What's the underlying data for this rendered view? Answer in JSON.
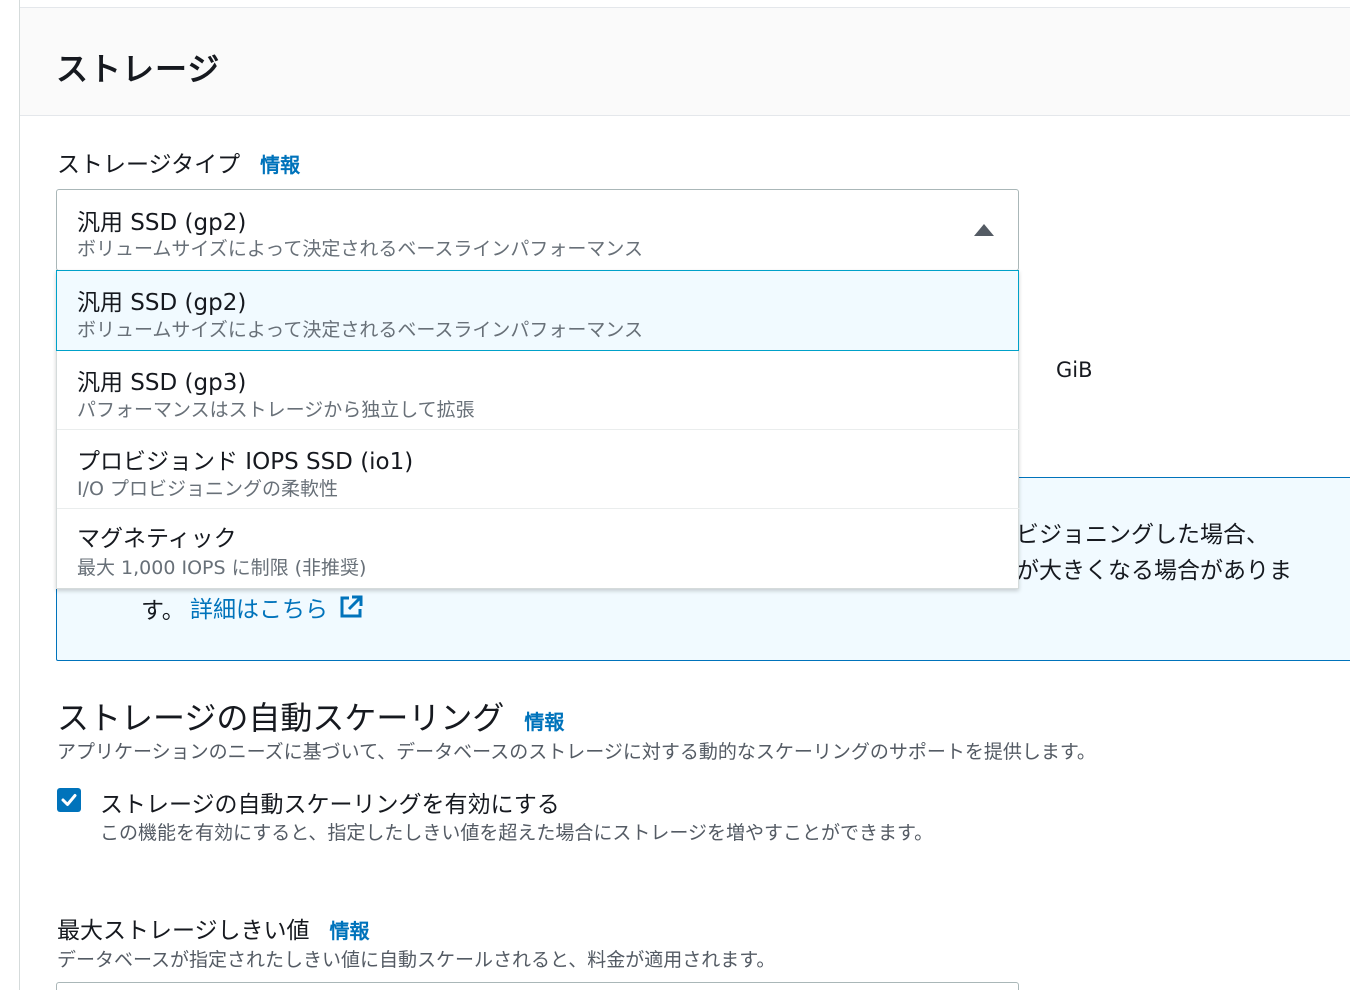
{
  "panel": {
    "title": "ストレージ"
  },
  "storage_type": {
    "label": "ストレージタイプ",
    "info_link": "情報",
    "selected": {
      "title": "汎用 SSD (gp2)",
      "description": "ボリュームサイズによって決定されるベースラインパフォーマンス"
    },
    "options": [
      {
        "title": "汎用 SSD (gp2)",
        "description": "ボリュームサイズによって決定されるベースラインパフォーマンス"
      },
      {
        "title": "汎用 SSD (gp3)",
        "description": "パフォーマンスはストレージから独立して拡張"
      },
      {
        "title": "プロビジョンド IOPS SSD (io1)",
        "description": "I/O プロビジョニングの柔軟性"
      },
      {
        "title": "マグネティック",
        "description": "最大 1,000 IOPS に制限 (非推奨)"
      }
    ]
  },
  "allocated_storage": {
    "unit": "GiB"
  },
  "alert": {
    "line1_visible": "ビジョニングした場合、",
    "line2_visible": "が大きくなる場合がありま",
    "line3": "す。",
    "link_text": "詳細はこちら"
  },
  "autoscaling": {
    "heading": "ストレージの自動スケーリング",
    "info_link": "情報",
    "description": "アプリケーションのニーズに基づいて、データベースのストレージに対する動的なスケーリングのサポートを提供します。",
    "checkbox_label": "ストレージの自動スケーリングを有効にする",
    "checkbox_checked": true,
    "checkbox_description": "この機能を有効にすると、指定したしきい値を超えた場合にストレージを増やすことができます。"
  },
  "max_threshold": {
    "label": "最大ストレージしきい値",
    "info_link": "情報",
    "description": "データベースが指定されたしきい値に自動スケールされると、料金が適用されます。"
  },
  "colors": {
    "link": "#0073bb",
    "selected_bg": "#f1faff",
    "selected_border": "#00a1c9",
    "checkbox": "#0073bb"
  },
  "icons": {
    "caret": "caret-up-icon",
    "external_link": "external-link-icon",
    "check": "check-icon"
  }
}
